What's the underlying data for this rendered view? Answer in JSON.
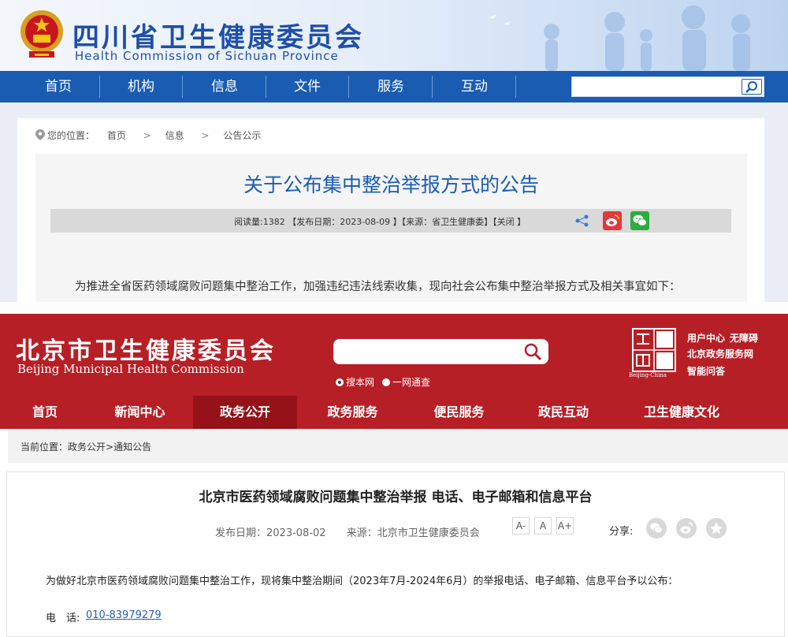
{
  "sichuan": {
    "title": "四川省卫生健康委员会",
    "subtitle": "Health Commission of Sichuan Province",
    "nav": [
      "首页",
      "机构",
      "信息",
      "文件",
      "服务",
      "互动"
    ],
    "search": {
      "placeholder": ""
    },
    "breadcrumb": {
      "label": "您的位置：",
      "items": [
        "首页",
        "信息",
        "公告公示"
      ],
      "separator": ">"
    },
    "article": {
      "title": "关于公布集中整治举报方式的公告",
      "meta": "阅读量:1382 【发布日期：2023-08-09 】【来源：省卫生健康委】【关闭 】",
      "body": "为推进全省医药领域腐败问题集中整治工作，加强违纪违法线索收集，现向社会公布集中整治举报方式及相关事宜如下："
    },
    "icons": [
      "location-icon",
      "search-icon",
      "share-icon",
      "weibo-icon",
      "wechat-icon"
    ],
    "colors": {
      "nav": "#1a5cb1",
      "title": "#1f4fa6"
    }
  },
  "beijing": {
    "title": "北京市卫生健康委员会",
    "subtitle": "Beijing Municipal Health Commission",
    "search": {
      "placeholder": "",
      "options": [
        "搜本网",
        "一网通查"
      ],
      "selected": "搜本网"
    },
    "seal_caption": "Beijing-China",
    "quick_links": [
      "用户中心",
      "无障碍",
      "北京政务服务网",
      "智能问答"
    ],
    "nav": [
      "首页",
      "新闻中心",
      "政务公开",
      "政务服务",
      "便民服务",
      "政民互动",
      "卫生健康文化"
    ],
    "nav_active": "政务公开",
    "breadcrumb": {
      "label": "当前位置：",
      "items": [
        "政务公开",
        "通知公告"
      ],
      "separator": ">"
    },
    "article": {
      "title": "北京市医药领域腐败问题集中整治举报 电话、电子邮箱和信息平台",
      "date": "发布日期：2023-08-02",
      "source": "来源：北京市卫生健康委员会",
      "font_sizes": [
        "A-",
        "A",
        "A+"
      ],
      "share_label": "分享:",
      "intro": "为做好北京市医药领域腐败问题集中整治工作，现将集中整治期间（2023年7月-2024年6月）的举报电话、电子邮箱、信息平台予以公布：",
      "phone_label": "电　话:",
      "phone": "010-83979279"
    },
    "icons": [
      "search-icon",
      "wechat-icon",
      "weibo-icon",
      "favorite-icon"
    ],
    "colors": {
      "header": "#b71f26",
      "nav_active": "#951219",
      "link": "#2a5db0"
    }
  }
}
